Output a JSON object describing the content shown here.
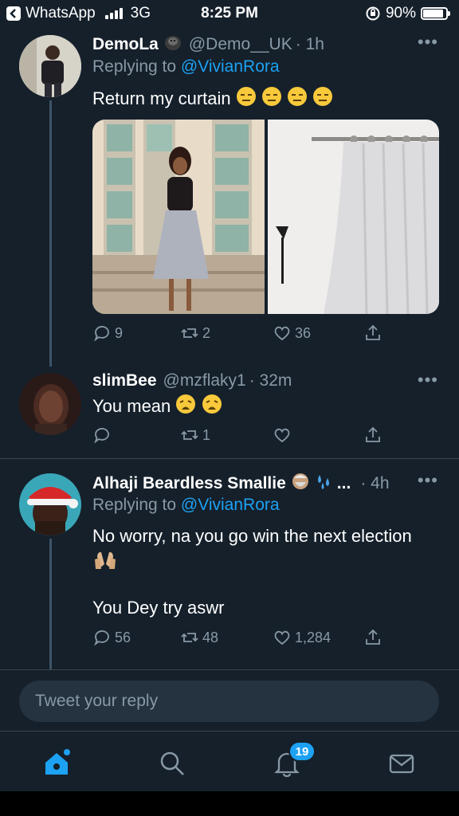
{
  "status_bar": {
    "back_app": "WhatsApp",
    "network": "3G",
    "time": "8:25 PM",
    "battery": "90%",
    "battery_level": 0.9
  },
  "tweets": [
    {
      "name": "DemoLa",
      "handle": "@Demo__UK",
      "time": "· 1h",
      "replying_prefix": "Replying to",
      "replying_to": "@VivianRora",
      "text": "Return my curtain",
      "emoji": [
        "expressionless-face",
        "expressionless-face",
        "expressionless-face",
        "expressionless-face"
      ],
      "replies": "9",
      "retweets": "2",
      "likes": "36"
    },
    {
      "name": "slimBee",
      "handle": "@mzflaky1",
      "time": "· 32m",
      "text": "You mean",
      "emoji": [
        "weary-face",
        "weary-face"
      ],
      "replies": "",
      "retweets": "1",
      "likes": ""
    },
    {
      "name": "Alhaji Beardless Smallie",
      "handle": "",
      "name_suffix": "...",
      "time": "· 4h",
      "replying_prefix": "Replying to",
      "replying_to": "@VivianRora",
      "text_line1": "No worry, na you go win the next election",
      "text_line2": "You Dey try aswr",
      "replies": "56",
      "retweets": "48",
      "likes": "1,284"
    }
  ],
  "compose": {
    "placeholder": "Tweet your reply"
  },
  "bottom_nav": {
    "notifications_badge": "19",
    "active": "home"
  },
  "colors": {
    "background": "#15202b",
    "accent": "#1da1f2",
    "muted": "#8899a6",
    "divider": "#38444d"
  }
}
